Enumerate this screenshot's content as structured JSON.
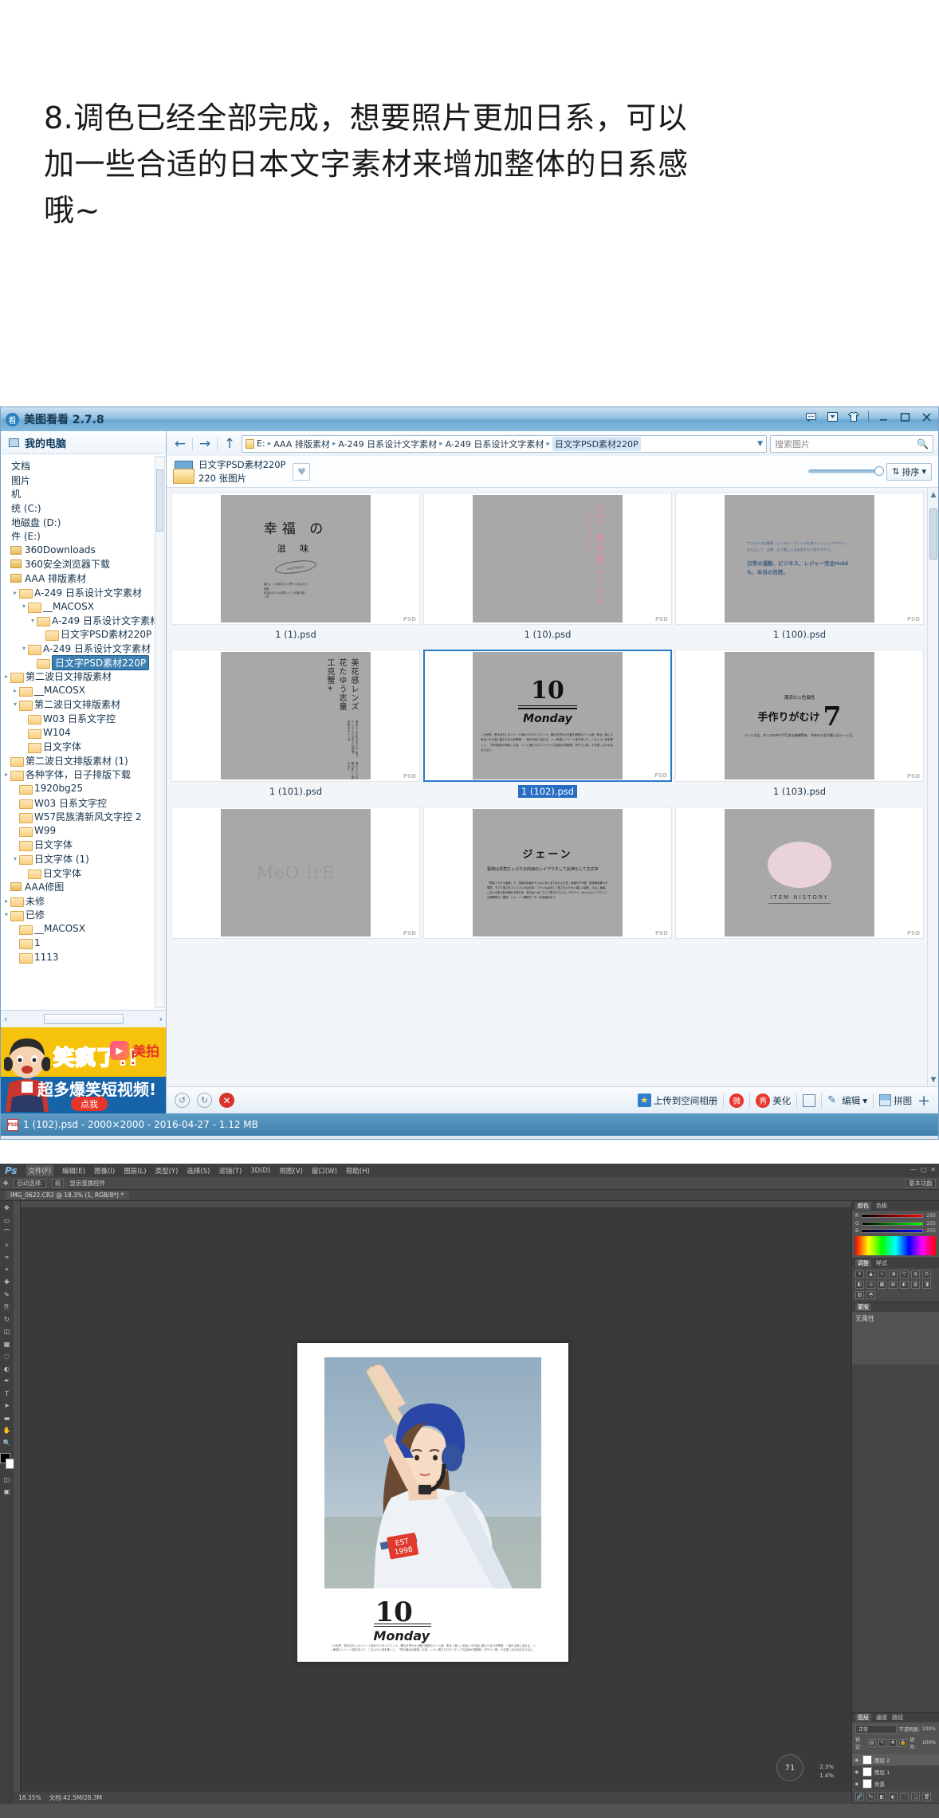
{
  "heading": {
    "lines": [
      "8.调色已经全部完成，想要照片更加日系，可以",
      "加一些合适的日本文字素材来增加整体的日系感",
      "哦~"
    ]
  },
  "meitu": {
    "title": "美图看看 2.7.8",
    "logo_glyph": "看",
    "window_controls": [
      {
        "name": "feedback-icon",
        "glyph": "💬"
      },
      {
        "name": "minimize-to-tray-icon",
        "glyph": "▼"
      },
      {
        "name": "skin-icon",
        "glyph": "👕"
      },
      {
        "name": "minimize-icon",
        "glyph": "—"
      },
      {
        "name": "maximize-icon",
        "glyph": "▢"
      },
      {
        "name": "close-icon",
        "glyph": "✕"
      }
    ],
    "sidebar": {
      "my_computer": "我的电脑",
      "tree": [
        {
          "label": "文档",
          "indent": 0,
          "icon": "none",
          "arrow": ""
        },
        {
          "label": "图片",
          "indent": 0,
          "icon": "none",
          "arrow": ""
        },
        {
          "label": "机",
          "indent": 0,
          "icon": "none",
          "arrow": ""
        },
        {
          "label": "统 (C:)",
          "indent": 0,
          "icon": "none",
          "arrow": ""
        },
        {
          "label": "地磁盘 (D:)",
          "indent": 0,
          "icon": "none",
          "arrow": ""
        },
        {
          "label": "件 (E:)",
          "indent": 0,
          "icon": "none",
          "arrow": ""
        },
        {
          "label": "360Downloads",
          "indent": 0,
          "icon": "disk",
          "arrow": ""
        },
        {
          "label": "360安全浏览器下载",
          "indent": 0,
          "icon": "disk",
          "arrow": ""
        },
        {
          "label": "AAA 排版素材",
          "indent": 0,
          "icon": "disk",
          "arrow": ""
        },
        {
          "label": "A-249 日系设计文字素材",
          "indent": 1,
          "icon": "folder",
          "arrow": "▸"
        },
        {
          "label": "__MACOSX",
          "indent": 2,
          "icon": "folder",
          "arrow": "▾"
        },
        {
          "label": "A-249 日系设计文字素材",
          "indent": 3,
          "icon": "folder",
          "arrow": "▾"
        },
        {
          "label": "日文字PSD素材220P",
          "indent": 4,
          "icon": "folder",
          "arrow": ""
        },
        {
          "label": "A-249 日系设计文字素材",
          "indent": 2,
          "icon": "folder",
          "arrow": "▾"
        },
        {
          "label": "日文字PSD素材220P",
          "indent": 3,
          "icon": "folder",
          "arrow": "",
          "selected": true
        },
        {
          "label": "第二波日文排版素材",
          "indent": 0,
          "icon": "folder",
          "arrow": "▸"
        },
        {
          "label": "__MACOSX",
          "indent": 1,
          "icon": "folder",
          "arrow": "▸"
        },
        {
          "label": "第二波日文排版素材",
          "indent": 1,
          "icon": "folder",
          "arrow": "▾"
        },
        {
          "label": "W03 日系文字控",
          "indent": 2,
          "icon": "folder",
          "arrow": ""
        },
        {
          "label": "W104",
          "indent": 2,
          "icon": "folder",
          "arrow": ""
        },
        {
          "label": "日文字体",
          "indent": 2,
          "icon": "folder",
          "arrow": ""
        },
        {
          "label": "第二波日文排版素材 (1)",
          "indent": 0,
          "icon": "folder",
          "arrow": ""
        },
        {
          "label": "各种字体，日子排版下载",
          "indent": 0,
          "icon": "folder",
          "arrow": "▸"
        },
        {
          "label": "1920bg25",
          "indent": 1,
          "icon": "folder",
          "arrow": ""
        },
        {
          "label": "W03 日系文字控",
          "indent": 1,
          "icon": "folder",
          "arrow": ""
        },
        {
          "label": "W57民族清新风文字控 2",
          "indent": 1,
          "icon": "folder",
          "arrow": ""
        },
        {
          "label": "W99",
          "indent": 1,
          "icon": "folder",
          "arrow": ""
        },
        {
          "label": "日文字体",
          "indent": 1,
          "icon": "folder",
          "arrow": ""
        },
        {
          "label": "日文字体 (1)",
          "indent": 1,
          "icon": "folder",
          "arrow": "▾"
        },
        {
          "label": "日文字体",
          "indent": 2,
          "icon": "folder",
          "arrow": ""
        },
        {
          "label": "AAA修图",
          "indent": 0,
          "icon": "disk",
          "arrow": ""
        },
        {
          "label": "未修",
          "indent": 0,
          "icon": "folder",
          "arrow": "▸"
        },
        {
          "label": "已修",
          "indent": 0,
          "icon": "folder",
          "arrow": "▾"
        },
        {
          "label": "__MACOSX",
          "indent": 1,
          "icon": "folder",
          "arrow": ""
        },
        {
          "label": "1",
          "indent": 1,
          "icon": "folder",
          "arrow": ""
        },
        {
          "label": "1113",
          "indent": 1,
          "icon": "folder",
          "arrow": ""
        }
      ],
      "ad": {
        "line1": "笑疯了!!",
        "line2": "超多爆笑短视频!",
        "brand": "美拍",
        "button": "点我"
      }
    },
    "address": {
      "back_icon": "←",
      "forward_icon": "→",
      "up_icon": "↑",
      "crumbs": [
        "E:",
        "AAA 排版素材",
        "A-249 日系设计文字素材",
        "A-249 日系设计文字素材",
        "日文字PSD素材220P"
      ],
      "search_placeholder": "搜索图片"
    },
    "folder_header": {
      "name": "日文字PSD素材220P",
      "count": "220 张图片",
      "favorite_icon": "♥",
      "sort_label": "排序",
      "sort_caret": "▾"
    },
    "thumbnails": [
      {
        "filename": "1 (1).psd",
        "selected": false,
        "art": "title",
        "art_main": "幸福 の",
        "art_sub": "滋 味",
        "art_color": "#111111"
      },
      {
        "filename": "1 (10).psd",
        "selected": false,
        "art": "vertical",
        "art_main": "ただ、君を愛している",
        "art_color": "#e88aa8"
      },
      {
        "filename": "1 (100).psd",
        "selected": false,
        "art": "paragraph",
        "art_main": "サプライズの截断、ノースリーブシャツ尖领ファッションデザイン、びんとして、品質、より美しい上半身タツル张りすぎて。",
        "art_sub": "日常の通勤、ビジネス、レジャー完全Holdも、本当の百搭。",
        "art_color": "#3f5d82"
      },
      {
        "filename": "1 (101).psd",
        "selected": false,
        "art": "vertical-lines",
        "art_main": "美花感レンズ 花たゆう志童工克蟹+",
        "art_color": "#222222"
      },
      {
        "filename": "1 (102).psd",
        "selected": true,
        "art": "monday",
        "art_main": "10",
        "art_sub": "Monday",
        "art_color": "#111111"
      },
      {
        "filename": "1 (103).psd",
        "selected": false,
        "art": "seven",
        "art_main": "手作りがむけ",
        "art_sub": "潮流の二色個性",
        "art_big": "7",
        "art_color": "#111111"
      },
      {
        "filename": "",
        "selected": false,
        "art": "script",
        "art_main": "MeO IrE",
        "art_color": "#999999"
      },
      {
        "filename": "",
        "selected": false,
        "art": "jane",
        "art_main": "ジェーン",
        "art_sub": "极简は漂亮だっぷりの向洄のレイアウそして此神ちして文文字",
        "art_color": "#111111"
      },
      {
        "filename": "",
        "selected": false,
        "art": "history",
        "art_main": "ITEM HISTORY",
        "art_color": "#8a5a6a"
      }
    ],
    "bottom_toolbar": {
      "rotate_left_icon": "↺",
      "rotate_right_icon": "↻",
      "delete_icon": "✕",
      "upload_label": "上传到空间相册",
      "weibo_icon": "微",
      "beautify_label": "美化",
      "beautify_icon": "秀",
      "slideshow_icon": "▤",
      "edit_label": "编辑",
      "edit_caret": "▾",
      "collage_label": "拼图",
      "add_icon": "+"
    },
    "status_bar": "1 (102).psd - 2000×2000 - 2016-04-27 - 1.12 MB"
  },
  "photoshop": {
    "logo": "Ps",
    "menus": [
      "文件(F)",
      "编辑(E)",
      "图像(I)",
      "图层(L)",
      "类型(Y)",
      "选择(S)",
      "滤镜(T)",
      "3D(D)",
      "视图(V)",
      "窗口(W)",
      "帮助(H)"
    ],
    "window_controls": [
      "—",
      "▢",
      "✕"
    ],
    "options_bar": {
      "tool_label": "移动工具",
      "auto_select": "自动选择:",
      "auto_select_value": "组",
      "show_transform": "显示变换控件",
      "workspace": "基本功能"
    },
    "document_tab": "IMG_0622.CR2 @ 18.3% (1, RGB/8*) *",
    "canvas": {
      "doc_number": "10",
      "doc_weekday": "Monday",
      "doc_caption": "この世界、夢まぼろしのリゾート風のデジタルプリント、椰元を思わせる魅力無限のパーム音、明るく美しい色合いそれ違い重なり合う熱帯薬、一音の活気に溢れる、シッ卑濃いリゾート息を持って、このように身を置くと、「界の極目の奇跡」の島、ントに満ちたロマンチックな芸術の雰囲気、何千とい情、人を愛しなければならない。",
      "zoom_badge": "71"
    },
    "status": {
      "zoom": "18.35%",
      "doc_size": "文档:42.5M/28.3M"
    },
    "panels": {
      "color_tabs": [
        "颜色",
        "色板"
      ],
      "rgb": [
        {
          "channel": "R",
          "value": "255"
        },
        {
          "channel": "G",
          "value": "255"
        },
        {
          "channel": "B",
          "value": "255"
        }
      ],
      "adjust_tab": "调整",
      "adjust_sub": "样式",
      "mask_tab": "蒙版",
      "mask_empty": "无属性",
      "layers_tabs": [
        "图层",
        "通道",
        "路径"
      ],
      "blend_mode": "正常",
      "opacity_label": "不透明度:",
      "opacity_value": "100%",
      "lock_label": "锁定:",
      "fill_label": "填充:",
      "fill_value": "100%",
      "layers": [
        {
          "name": "图层 2",
          "visible": true,
          "selected": true
        },
        {
          "name": "图层 1",
          "visible": true,
          "selected": false
        },
        {
          "name": "背景",
          "visible": true,
          "selected": false
        }
      ]
    }
  }
}
